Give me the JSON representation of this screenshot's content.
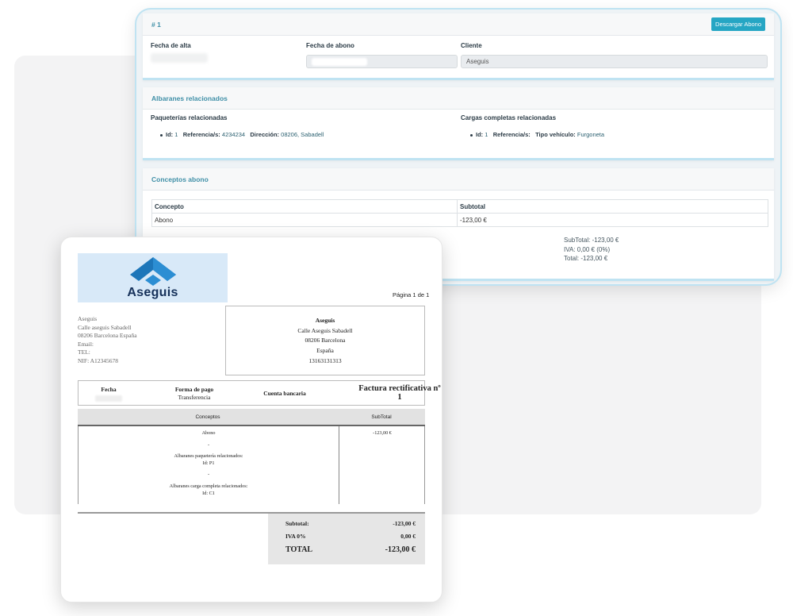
{
  "app": {
    "card1": {
      "title": "# 1",
      "download_button": "Descargar Abono",
      "fecha_alta_label": "Fecha de alta",
      "fecha_abono_label": "Fecha de abono",
      "cliente_label": "Cliente",
      "cliente_value": "Aseguis"
    },
    "card2": {
      "title": "Albaranes relacionados",
      "paqueterias_title": "Paqueterías relacionadas",
      "paqueteria": {
        "id_label": "Id:",
        "id_value": "1",
        "ref_label": "Referencia/s:",
        "ref_value": "4234234",
        "dir_label": "Dirección:",
        "dir_value": "08206, Sabadell"
      },
      "cargas_title": "Cargas completas relacionadas",
      "carga": {
        "id_label": "Id:",
        "id_value": "1",
        "ref_label": "Referencia/s:",
        "tipo_label": "Tipo vehículo:",
        "tipo_value": "Furgoneta"
      }
    },
    "card3": {
      "title": "Conceptos abono",
      "table": {
        "headers": [
          "Concepto",
          "Subtotal"
        ],
        "rows": [
          [
            "Abono",
            "-123,00 €"
          ]
        ]
      },
      "totals": {
        "subtotal": "SubTotal: -123,00 €",
        "iva": "IVA: 0,00 € (0%)",
        "total": "Total: -123,00 €"
      }
    }
  },
  "doc": {
    "logo_text": "Aseguis",
    "page_num": "Página 1 de 1",
    "sender": [
      "Aseguis",
      "Calle aseguis Sabadell",
      "08206 Barcelona España",
      "Email:",
      "TEL:",
      "NIF: A12345678"
    ],
    "client": {
      "name": "Aseguis",
      "street": "Calle Aseguis Sabadell",
      "city": "08206 Barcelona",
      "country": "España",
      "phone": "13163131313"
    },
    "info": {
      "fecha_label": "Fecha",
      "forma_pago_label": "Forma de pago",
      "forma_pago_value": "Transferencia",
      "cuenta_label": "Cuenta bancaria",
      "invoice_title_1": "Factura rectificativa nº",
      "invoice_title_2": "1"
    },
    "items": {
      "header_concept": "Conceptos",
      "header_subtotal": "SubTotal",
      "lines": [
        "Abono",
        "-",
        "Albaranes paquetería relacionados:",
        "Id: P1",
        "-",
        "Albaranes carga completa relacionados:",
        "Id: C1"
      ],
      "amount": "-123,00 €"
    },
    "summary": {
      "subtotal_label": "Subtotal:",
      "subtotal_value": "-123,00 €",
      "iva_label": "IVA 0%",
      "iva_value": "0,00 €",
      "total_label": "TOTAL",
      "total_value": "-123,00 €"
    }
  }
}
